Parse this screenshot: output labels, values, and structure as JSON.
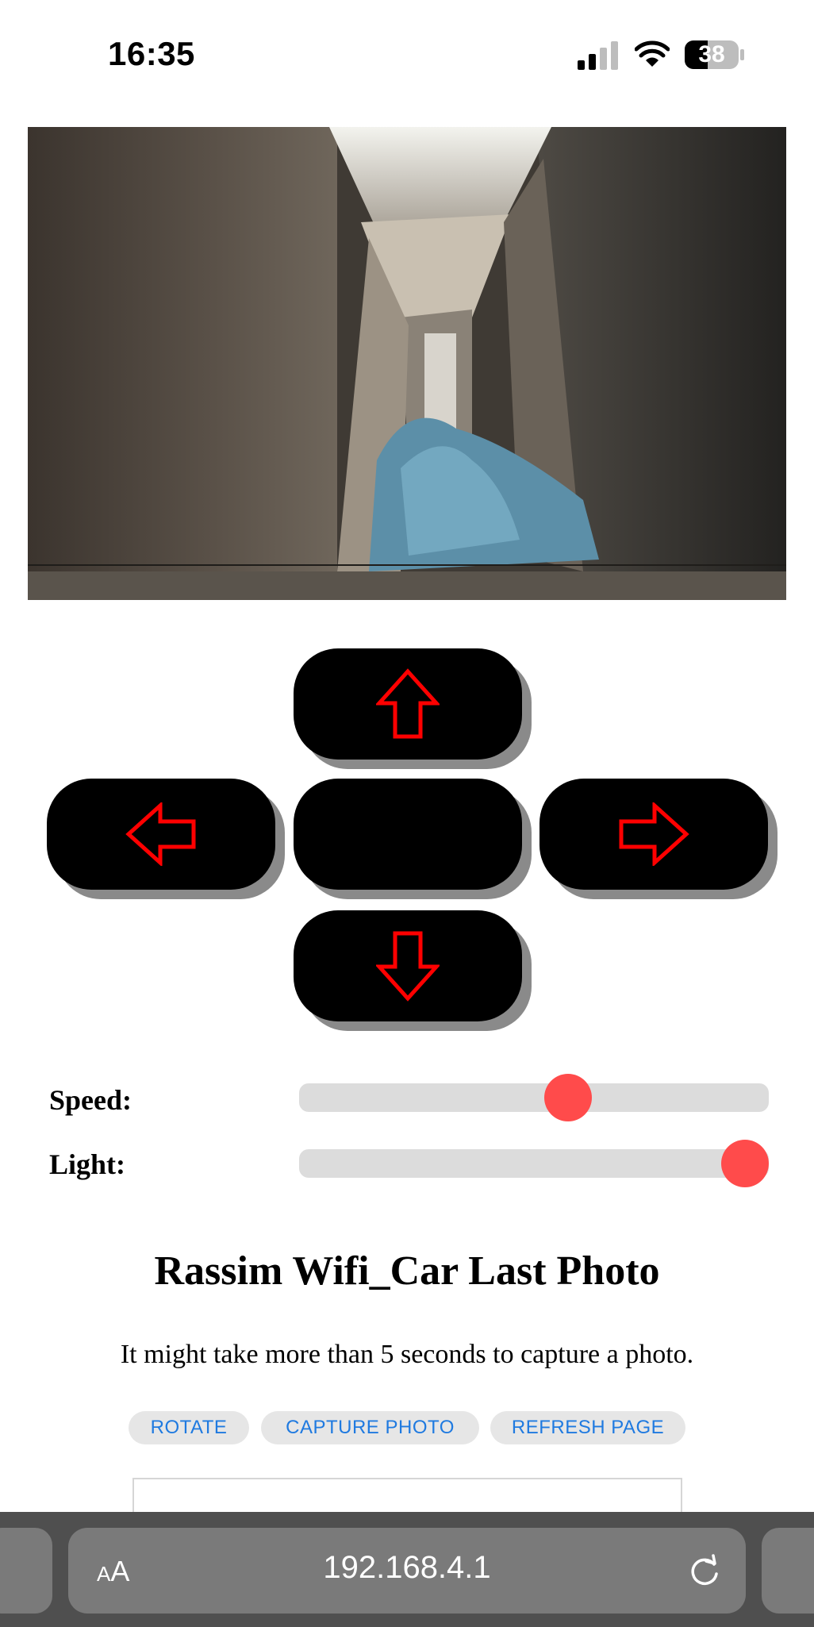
{
  "status_bar": {
    "time": "16:35",
    "battery_level": "38",
    "icons": [
      "signal-icon",
      "wifi-icon",
      "battery-icon"
    ]
  },
  "camera": {
    "icon": "camera-feed-image"
  },
  "dpad": {
    "up_icon": "arrow-up-icon",
    "left_icon": "arrow-left-icon",
    "right_icon": "arrow-right-icon",
    "down_icon": "arrow-down-icon",
    "arrow_color": "#ff0000",
    "button_color": "#000000"
  },
  "controls": {
    "speed_label": "Speed:",
    "speed_value": 0.58,
    "light_label": "Light:",
    "light_value": 1.0,
    "thumb_color": "#ff4b4b"
  },
  "photo": {
    "title": "Rassim Wifi_Car Last Photo",
    "note": "It might take more than 5 seconds to capture a photo.",
    "buttons": {
      "rotate": "ROTATE",
      "capture": "CAPTURE PHOTO",
      "refresh": "REFRESH PAGE"
    },
    "button_text_color": "#1f7ae0"
  },
  "browser": {
    "aa_small": "A",
    "aa_big": "A",
    "url": "192.168.4.1",
    "reload_icon": "reload-icon"
  }
}
